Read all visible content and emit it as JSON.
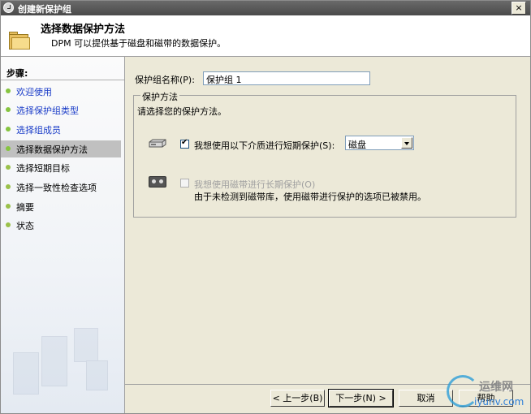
{
  "window": {
    "title": "创建新保护组",
    "close_glyph": "×"
  },
  "header": {
    "title": "选择数据保护方法",
    "subtitle": "DPM 可以提供基于磁盘和磁带的数据保护。"
  },
  "sidebar": {
    "steps_label": "步骤:",
    "items": [
      {
        "label": "欢迎使用"
      },
      {
        "label": "选择保护组类型"
      },
      {
        "label": "选择组成员"
      },
      {
        "label": "选择数据保护方法"
      },
      {
        "label": "选择短期目标"
      },
      {
        "label": "选择一致性检查选项"
      },
      {
        "label": "摘要"
      },
      {
        "label": "状态"
      }
    ]
  },
  "main": {
    "group_name_label": "保护组名称(P):",
    "group_name_value": "保护组 1",
    "method_group": {
      "legend": "保护方法",
      "description": "请选择您的保护方法。",
      "short_term_label": "我想使用以下介质进行短期保护(S):",
      "short_term_checked": true,
      "short_term_medium": "磁盘",
      "long_term_label": "我想使用磁带进行长期保护(O)",
      "long_term_checked": false,
      "long_term_note": "由于未检测到磁带库，使用磁带进行保护的选项已被禁用。"
    }
  },
  "footer": {
    "back_label": "< 上一步(B)",
    "next_label": "下一步(N) >",
    "cancel_label": "取消",
    "help_label": "帮助"
  },
  "watermark": {
    "line1": "运维网",
    "line2": "iyunv.com"
  },
  "colors": {
    "link_blue": "#1a3cc8",
    "step_dot": "#86c43f",
    "active_row": "#c0c0c0"
  }
}
